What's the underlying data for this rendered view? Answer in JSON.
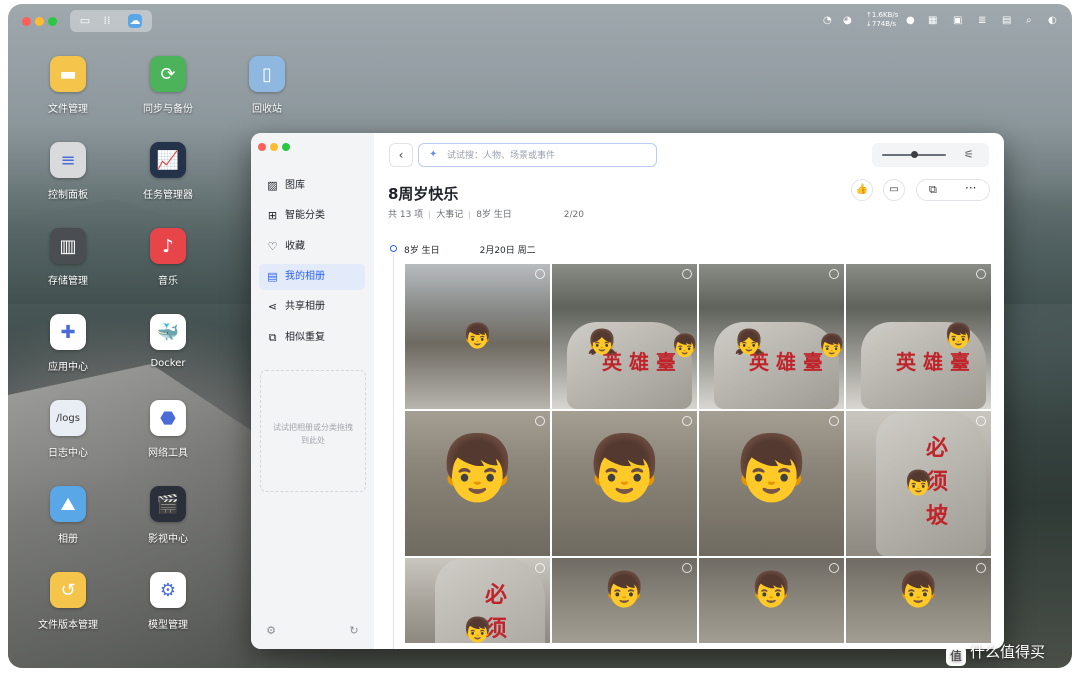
{
  "desktop": {
    "icons": [
      {
        "label": "文件管理",
        "icon": "folder-icon",
        "color": "#f5c44a"
      },
      {
        "label": "同步与备份",
        "icon": "sync-icon",
        "color": "#4cb35a"
      },
      {
        "label": "回收站",
        "icon": "trash-icon",
        "color": "#8fb8e0"
      },
      {
        "label": "控制面板",
        "icon": "control-panel-icon",
        "color": "#d8dadc"
      },
      {
        "label": "任务管理器",
        "icon": "task-manager-icon",
        "color": "#24324a"
      },
      {
        "label": "存储管理",
        "icon": "storage-icon",
        "color": "#4a4d52"
      },
      {
        "label": "音乐",
        "icon": "music-icon",
        "color": "#e8454a"
      },
      {
        "label": "应用中心",
        "icon": "app-center-icon",
        "color": "#ffffff"
      },
      {
        "label": "Docker",
        "icon": "docker-icon",
        "color": "#ffffff"
      },
      {
        "label": "日志中心",
        "icon": "logs-icon",
        "color": "#e9eef5",
        "tile_text": "/logs"
      },
      {
        "label": "网络工具",
        "icon": "network-tool-icon",
        "color": "#ffffff"
      },
      {
        "label": "相册",
        "icon": "photos-icon",
        "color": "#5aa7e8"
      },
      {
        "label": "影视中心",
        "icon": "video-center-icon",
        "color": "#2a2f3a"
      },
      {
        "label": "文件版本管理",
        "icon": "file-version-icon",
        "color": "#f5c44a"
      },
      {
        "label": "模型管理",
        "icon": "model-manager-icon",
        "color": "#ffffff"
      }
    ]
  },
  "topbar": {
    "upload_speed": "↑1.6KB/s",
    "download_speed": "↓774B/s",
    "cpu_label": "CPU",
    "ram_label": "RAM"
  },
  "window": {
    "sidebar": {
      "items": [
        {
          "label": "图库",
          "icon": "gallery-icon",
          "active": false
        },
        {
          "label": "智能分类",
          "icon": "smart-category-icon",
          "active": false
        },
        {
          "label": "收藏",
          "icon": "heart-icon",
          "active": false
        },
        {
          "label": "我的相册",
          "icon": "my-albums-icon",
          "active": true
        },
        {
          "label": "共享相册",
          "icon": "share-icon",
          "active": false
        },
        {
          "label": "相似重复",
          "icon": "duplicate-icon",
          "active": false
        }
      ],
      "dropzone_text": "试试把相册或分类拖拽到此处"
    },
    "search": {
      "placeholder": "试试搜：人物、场景或事件"
    },
    "zoom_level": 0.5,
    "album": {
      "title": "8周岁快乐",
      "count": "共 13 项",
      "tag": "大事记",
      "event": "8岁 生日",
      "date_range": "2/20"
    },
    "section": {
      "event": "8岁 生日",
      "date": "2月20日 周二"
    },
    "photos": [
      {
        "scene": "wall",
        "emoji": "👦",
        "hat": false
      },
      {
        "scene": "stone",
        "emoji": "👧",
        "second": "👦",
        "chars": "英 雄 臺"
      },
      {
        "scene": "stone",
        "emoji": "👧",
        "second": "👦",
        "chars": "英 雄 臺"
      },
      {
        "scene": "stone",
        "emoji": "👦",
        "chars": "英 雄 臺"
      },
      {
        "scene": "closeup",
        "emoji": "👦"
      },
      {
        "scene": "closeup",
        "emoji": "👦"
      },
      {
        "scene": "closeup",
        "emoji": "👦"
      },
      {
        "scene": "stone-red",
        "emoji": "👦",
        "chars": "必 须 坡"
      },
      {
        "scene": "stone-red",
        "emoji": "👦",
        "chars": "必 须"
      },
      {
        "scene": "steps",
        "emoji": "👦"
      },
      {
        "scene": "steps",
        "emoji": "👦"
      },
      {
        "scene": "steps",
        "emoji": "👦"
      }
    ]
  },
  "watermark": {
    "text": "什么值得买"
  }
}
